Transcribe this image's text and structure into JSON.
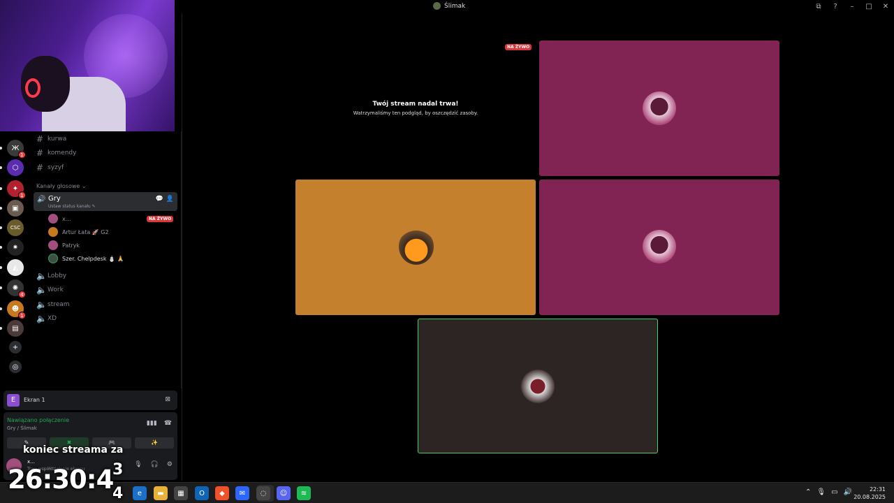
{
  "window": {
    "title": "Ślimak",
    "icons": {
      "screen": "⧉",
      "help": "?",
      "minimize": "–",
      "maximize": "□",
      "close": "✕"
    }
  },
  "rail": {
    "servers": [
      {
        "glyph": "Ж",
        "color": "#3a3a3a",
        "badge": "1"
      },
      {
        "glyph": "⬡",
        "color": "#5b2bb0",
        "badge": ""
      },
      {
        "glyph": "✦",
        "color": "#b3212f",
        "badge": "1"
      },
      {
        "glyph": "▣",
        "color": "#6b5a50",
        "badge": ""
      },
      {
        "glyph": "CSC",
        "color": "#6a5b2a",
        "badge": ""
      },
      {
        "glyph": "✷",
        "color": "#222",
        "badge": ""
      },
      {
        "glyph": "◭",
        "color": "#e8e8e8",
        "badge": ""
      },
      {
        "glyph": "✺",
        "color": "#333",
        "badge": "4"
      },
      {
        "glyph": "☻",
        "color": "#c8781e",
        "badge": "1"
      },
      {
        "glyph": "▤",
        "color": "#4b3a3a",
        "badge": ""
      }
    ],
    "add": "+",
    "explore": "◎"
  },
  "channels": {
    "text": [
      "kurwa",
      "komendy",
      "syzyf"
    ],
    "voice_category": "Kanały głosowe ⌄",
    "active_voice": {
      "name": "Gry",
      "status": "Ustaw status kanału ✎",
      "members": [
        {
          "name": "x...",
          "color": "#a34f7d",
          "live": "NA ŻYWO"
        },
        {
          "name": "Artur Łata 🚀 G2",
          "color": "#c8781e",
          "live": ""
        },
        {
          "name": "Patryk",
          "color": "#a34f7d",
          "live": ""
        },
        {
          "name": "Szer. Chelpdesk ⛄ 🙏",
          "color": "#3f4e44",
          "live": ""
        }
      ]
    },
    "voice": [
      "Lobby",
      "Work",
      "stream",
      "XD"
    ]
  },
  "screen_panel": {
    "initial": "E",
    "label": "Ekran 1",
    "icon": "⊠"
  },
  "connection": {
    "status": "Nawiązano połączenie",
    "location": "Gry / Ślimak",
    "buttons": [
      "✎",
      "✖",
      "🎮",
      "✨"
    ],
    "user": {
      "name": "x...",
      "status": "Trwa współdzielenie ekranu"
    }
  },
  "overlay": {
    "label": "koniec streama za",
    "timer": "26:30:4",
    "timer_tail_top": "3",
    "timer_tail_bottom": "4"
  },
  "stage": {
    "live_tag": "NA ŻYWO",
    "paused_title": "Twój stream nadal trwa!",
    "paused_subtitle": "Watrzymaliśmy ten podgląd, by oszczędzić zasoby.",
    "tile_colors": {
      "pink": "#812453",
      "orange": "#c5802e",
      "dark": "#2c2523"
    }
  },
  "taskbar": {
    "apps": [
      {
        "glyph": "e",
        "color": "#1c6fc8"
      },
      {
        "glyph": "▬",
        "color": "#e8b23a"
      },
      {
        "glyph": "▦",
        "color": "#444"
      },
      {
        "glyph": "O",
        "color": "#1064b4"
      },
      {
        "glyph": "◆",
        "color": "#f0502a"
      },
      {
        "glyph": "✉",
        "color": "#2c66ff"
      },
      {
        "glyph": "◌",
        "color": "#444"
      },
      {
        "glyph": "☺",
        "color": "#5865f2"
      },
      {
        "glyph": "≋",
        "color": "#1db954"
      }
    ],
    "tray": [
      "⌃",
      "🎙",
      "▭",
      "🔊"
    ],
    "time": "22:31",
    "date": "20.08.2025"
  }
}
